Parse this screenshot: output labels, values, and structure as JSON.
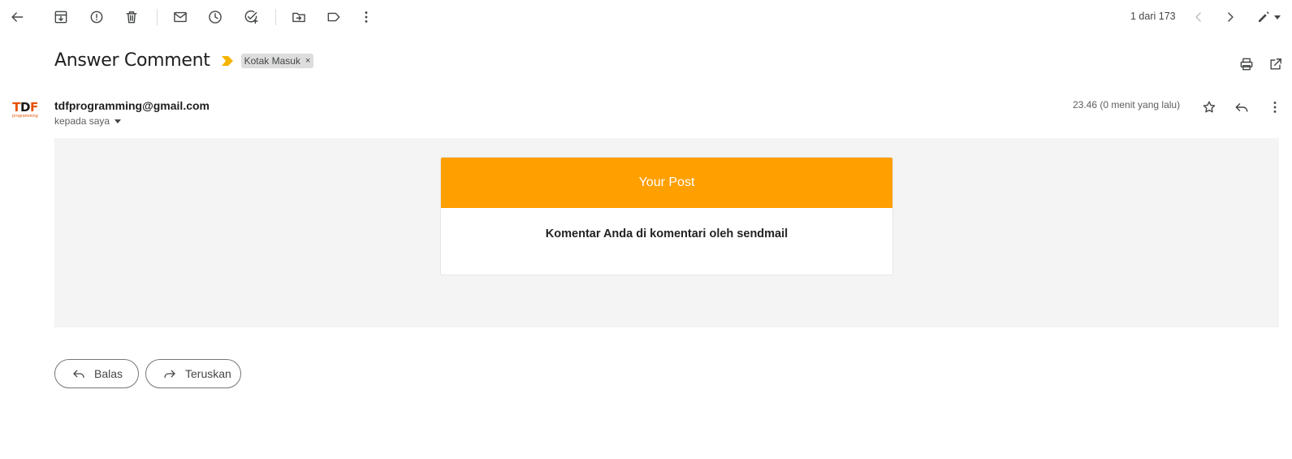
{
  "toolbar": {
    "back": "back-arrow-icon",
    "archive": "archive-icon",
    "report_spam": "report-spam-icon",
    "delete": "trash-icon",
    "mark_unread": "mail-icon",
    "snooze": "clock-icon",
    "add_task": "add-task-icon",
    "move_to": "move-to-folder-icon",
    "labels": "label-icon",
    "more": "more-vert-icon"
  },
  "pager": {
    "text": "1 dari 173",
    "prev": "chevron-left-icon",
    "next": "chevron-right-icon",
    "edit": "pen-icon"
  },
  "message": {
    "subject": "Answer Comment",
    "label": "Kotak Masuk",
    "label_close": "×",
    "sender": "tdfprogramming@gmail.com",
    "recipient": "kepada saya",
    "timestamp": "23.46 (0 menit yang lalu)",
    "avatar_logo": {
      "t": "T",
      "d": "D",
      "f": "F",
      "sub": "programming"
    }
  },
  "body": {
    "card_title": "Your Post",
    "card_text": "Komentar Anda di komentari oleh sendmail"
  },
  "actions": {
    "reply_label": "Balas",
    "forward_label": "Teruskan"
  },
  "colors": {
    "accent_orange": "#ff9f00",
    "body_bg": "#f4f4f4",
    "important_marker": "#f4b400"
  }
}
